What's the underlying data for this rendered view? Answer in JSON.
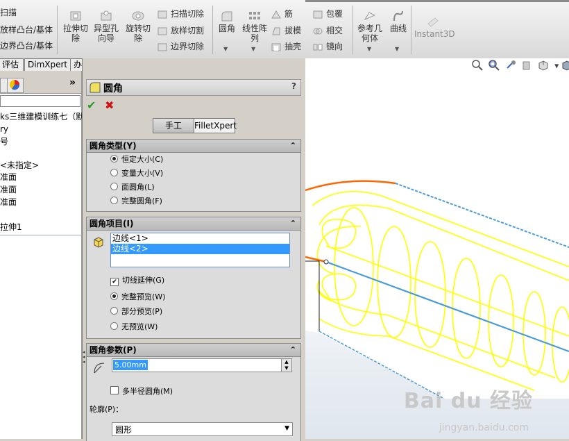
{
  "ribbon": {
    "left_items": [
      "扫描",
      "放样凸台/基体",
      "边界凸台/基体"
    ],
    "cut_buttons": [
      {
        "label": "拉伸切\n除",
        "icon": "extruded-cut-icon"
      },
      {
        "label": "异型孔\n向导",
        "icon": "hole-wizard-icon"
      },
      {
        "label": "旋转切\n除",
        "icon": "revolved-cut-icon"
      }
    ],
    "cut_small": [
      "扫描切除",
      "放样切割",
      "边界切除"
    ],
    "feature_buttons": [
      {
        "label": "圆角",
        "icon": "fillet-icon"
      },
      {
        "label": "线性阵\n列",
        "icon": "linear-pattern-icon"
      }
    ],
    "feature_small_col1": [
      "筋",
      "拔模",
      "抽壳"
    ],
    "feature_small_col2": [
      "包覆",
      "相交",
      "镜向"
    ],
    "ref_buttons": [
      {
        "label": "参考几\n何体",
        "icon": "reference-geometry-icon"
      },
      {
        "label": "曲线",
        "icon": "curves-icon"
      }
    ],
    "instant3d": "Instant3D"
  },
  "tabs": [
    "评估",
    "DimXpert",
    "办公室产品"
  ],
  "tree": {
    "expand_symbol": "»",
    "items": [
      "ks三维建模训练七（默",
      "ry",
      "号",
      "<未指定>",
      "准面",
      "准面",
      "准面",
      "拉伸1"
    ]
  },
  "pm": {
    "title": "圆角",
    "help": "?",
    "ok_symbol": "✔",
    "cancel_symbol": "✖",
    "mode_manual": "手工",
    "mode_expert": "FilletXpert",
    "type_group": {
      "title": "圆角类型(Y)",
      "options": [
        "恒定大小(C)",
        "变量大小(V)",
        "面圆角(L)",
        "完整圆角(F)"
      ],
      "selected": 0
    },
    "items_group": {
      "title": "圆角项目(I)",
      "edges": [
        "边线<1>",
        "边线<2>"
      ],
      "selected_edge": 1,
      "tangent": "切线延伸(G)",
      "preview_options": [
        "完整预览(W)",
        "部分预览(P)",
        "无预览(W)"
      ],
      "preview_selected": 0
    },
    "params_group": {
      "title": "圆角参数(P)",
      "radius": "5.00mm",
      "multi_radius": "多半径圆角(M)",
      "profile_label": "轮廓(P)：",
      "profile_value": "圆形"
    }
  },
  "watermark": {
    "text": "Bai du 经验",
    "url": "jingyan.baidu.com"
  },
  "colors": {
    "highlight": "#3399ff",
    "model_yellow": "#ffff00",
    "edge_orange": "#ff6600",
    "edge_blue": "#4a9ad8"
  }
}
